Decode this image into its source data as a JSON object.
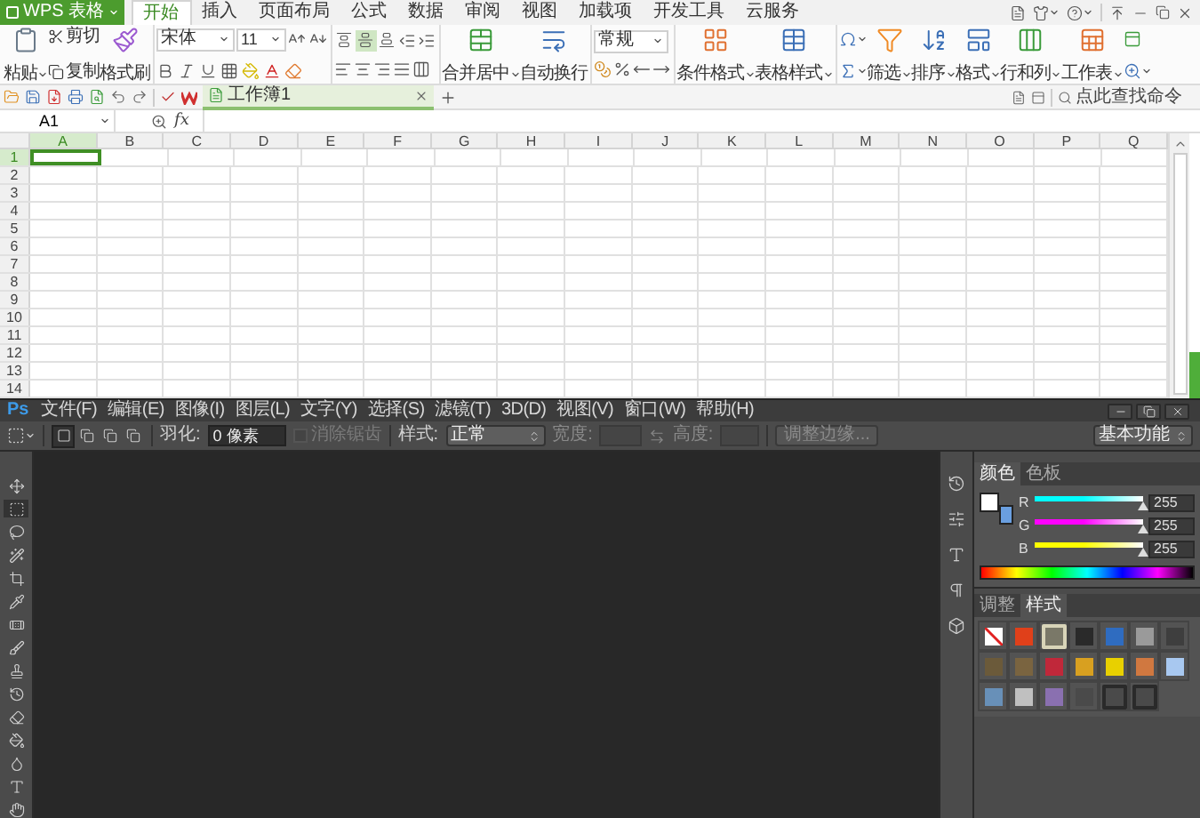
{
  "wps": {
    "app_button": "WPS 表格",
    "tabs": [
      {
        "label": "开始",
        "selected": true
      },
      {
        "label": "插入",
        "selected": false
      },
      {
        "label": "页面布局",
        "selected": false
      },
      {
        "label": "公式",
        "selected": false
      },
      {
        "label": "数据",
        "selected": false
      },
      {
        "label": "审阅",
        "selected": false
      },
      {
        "label": "视图",
        "selected": false
      },
      {
        "label": "加载项",
        "selected": false
      },
      {
        "label": "开发工具",
        "selected": false
      },
      {
        "label": "云服务",
        "selected": false
      }
    ],
    "ribbon": {
      "paste": "粘贴",
      "cut": "剪切",
      "copy": "复制",
      "format_painter": "格式刷",
      "font_name": "宋体",
      "font_size": "11",
      "vertical_align": [
        {
          "selected": false
        },
        {
          "selected": true
        },
        {
          "selected": false
        }
      ],
      "merge": "合并居中",
      "wrap": "自动换行",
      "number_format": "常规",
      "conditional_format": "条件格式",
      "table_style": "表格样式",
      "editing": [
        "筛选",
        "排序",
        "格式",
        "行和列",
        "工作表"
      ]
    },
    "document_tab": "工作簿1",
    "search_placeholder": "点此查找命令",
    "formula_bar": {
      "cell_ref": "A1",
      "fx": "fx"
    },
    "sheet": {
      "columns": [
        {
          "label": "A",
          "selected": true
        },
        {
          "label": "B",
          "selected": false
        },
        {
          "label": "C",
          "selected": false
        },
        {
          "label": "D",
          "selected": false
        },
        {
          "label": "E",
          "selected": false
        },
        {
          "label": "F",
          "selected": false
        },
        {
          "label": "G",
          "selected": false
        },
        {
          "label": "H",
          "selected": false
        },
        {
          "label": "I",
          "selected": false
        },
        {
          "label": "J",
          "selected": false
        },
        {
          "label": "K",
          "selected": false
        },
        {
          "label": "L",
          "selected": false
        },
        {
          "label": "M",
          "selected": false
        },
        {
          "label": "N",
          "selected": false
        },
        {
          "label": "O",
          "selected": false
        },
        {
          "label": "P",
          "selected": false
        },
        {
          "label": "Q",
          "selected": false
        }
      ],
      "rows": [
        {
          "label": "1",
          "selected": true
        },
        {
          "label": "2",
          "selected": false
        },
        {
          "label": "3",
          "selected": false
        },
        {
          "label": "4",
          "selected": false
        },
        {
          "label": "5",
          "selected": false
        },
        {
          "label": "6",
          "selected": false
        },
        {
          "label": "7",
          "selected": false
        },
        {
          "label": "8",
          "selected": false
        },
        {
          "label": "9",
          "selected": false
        },
        {
          "label": "10",
          "selected": false
        },
        {
          "label": "11",
          "selected": false
        },
        {
          "label": "12",
          "selected": false
        },
        {
          "label": "13",
          "selected": false
        },
        {
          "label": "14",
          "selected": false
        }
      ]
    }
  },
  "ps": {
    "logo": "Ps",
    "menus": [
      "文件(F)",
      "编辑(E)",
      "图像(I)",
      "图层(L)",
      "文字(Y)",
      "选择(S)",
      "滤镜(T)",
      "3D(D)",
      "视图(V)",
      "窗口(W)",
      "帮助(H)"
    ],
    "options": {
      "selection_modes": [
        {
          "selected": true
        },
        {
          "selected": false
        },
        {
          "selected": false
        },
        {
          "selected": false
        }
      ],
      "feather_label": "羽化:",
      "feather_value": "0 像素",
      "anti_alias": {
        "label": "消除锯齿",
        "checked": false,
        "disabled": true
      },
      "style_label": "样式:",
      "style_value": "正常",
      "width_label": "宽度:",
      "height_label": "高度:",
      "refine_button": "调整边缘...",
      "workspace": "基本功能"
    },
    "color_panel": {
      "tabs": [
        {
          "label": "颜色",
          "selected": true
        },
        {
          "label": "色板",
          "selected": false
        }
      ],
      "fg_bg": [
        {
          "color": "#ffffff"
        },
        {
          "color": "#6a9fe0"
        }
      ],
      "channels": [
        {
          "name": "R",
          "color": "#00ffff",
          "level": 1,
          "value": "255"
        },
        {
          "name": "G",
          "color": "#ff00ff",
          "level": 1,
          "value": "255"
        },
        {
          "name": "B",
          "color": "#ffff00",
          "level": 1,
          "value": "255"
        }
      ]
    },
    "styles_panel": {
      "tabs": [
        {
          "label": "调整",
          "selected": false
        },
        {
          "label": "样式",
          "selected": true
        }
      ],
      "swatches": [
        {
          "kind": "none",
          "color": "#ffffff",
          "selected": false
        },
        {
          "kind": "swatch",
          "color": "#e0401a",
          "selected": false
        },
        {
          "kind": "swatch",
          "color": "#7a7868",
          "selected": true
        },
        {
          "kind": "swatch",
          "color": "#2a2a2a",
          "selected": false
        },
        {
          "kind": "swatch",
          "color": "#2f6cc0",
          "selected": false
        },
        {
          "kind": "swatch",
          "color": "#9a9a9a",
          "selected": false
        },
        {
          "kind": "swatch",
          "color": "#3e3e3e",
          "selected": false
        },
        {
          "kind": "swatch",
          "color": "#6b5a3a",
          "selected": false
        },
        {
          "kind": "swatch",
          "color": "#7a6440",
          "selected": false
        },
        {
          "kind": "swatch",
          "color": "#c0283a",
          "selected": false
        },
        {
          "kind": "swatch",
          "color": "#d8a020",
          "selected": false
        },
        {
          "kind": "swatch",
          "color": "#e8d000",
          "selected": false
        },
        {
          "kind": "swatch",
          "color": "#d07840",
          "selected": false
        },
        {
          "kind": "swatch",
          "color": "#a8c8f0",
          "selected": false
        },
        {
          "kind": "swatch",
          "color": "#6890b8",
          "selected": false
        },
        {
          "kind": "swatch",
          "color": "#c0c0c0",
          "selected": false
        },
        {
          "kind": "swatch",
          "color": "#8a70b0",
          "selected": false
        },
        {
          "kind": "swatch",
          "color": "#4a4a4a",
          "selected": false
        },
        {
          "kind": "outline",
          "color": "#4a4a4a",
          "selected": false
        },
        {
          "kind": "outline",
          "color": "#4a4a4a",
          "selected": false
        }
      ]
    }
  }
}
